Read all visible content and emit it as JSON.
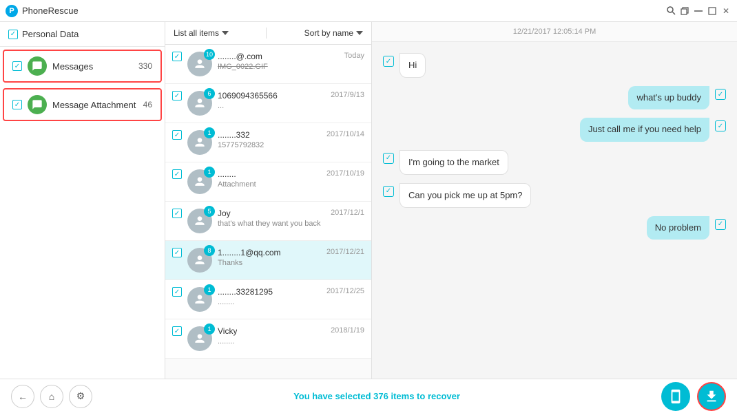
{
  "app": {
    "name": "PhoneRescue",
    "logo": "P"
  },
  "titlebar": {
    "controls": [
      "search",
      "restore",
      "minimize",
      "maximize",
      "close"
    ]
  },
  "sidebar": {
    "header": {
      "label": "Personal Data",
      "checked": true
    },
    "items": [
      {
        "id": "messages",
        "label": "Messages",
        "count": "330",
        "icon": "💬",
        "checked": true
      },
      {
        "id": "message-attachment",
        "label": "Message Attachment",
        "count": "46",
        "icon": "💬",
        "checked": true
      }
    ]
  },
  "middle": {
    "toolbar": {
      "list_label": "List all items",
      "sort_label": "Sort by name"
    },
    "messages": [
      {
        "id": 1,
        "badge": "10",
        "name": "........@.com",
        "date": "Today",
        "preview": "IMG_0022.GIF",
        "preview_strikethrough": true,
        "checked": true
      },
      {
        "id": 2,
        "badge": "6",
        "name": "1069094365566",
        "date": "2017/9/13",
        "preview": "...",
        "checked": true
      },
      {
        "id": 3,
        "badge": "1",
        "name": "........332",
        "date": "2017/10/14",
        "preview": "15775792832",
        "checked": true
      },
      {
        "id": 4,
        "badge": "1",
        "name": "........",
        "date": "2017/10/19",
        "preview": "Attachment",
        "checked": true
      },
      {
        "id": 5,
        "badge": "5",
        "name": "Joy",
        "date": "2017/12/1",
        "preview": "that's what they want you back",
        "checked": true
      },
      {
        "id": 6,
        "badge": "8",
        "name": "1........1@qq.com",
        "date": "2017/12/21",
        "preview": "Thanks",
        "checked": true,
        "active": true
      },
      {
        "id": 7,
        "badge": "1",
        "name": "........33281295",
        "date": "2017/12/25",
        "preview": "........",
        "checked": true
      },
      {
        "id": 8,
        "badge": "1",
        "name": "Vicky",
        "date": "2018/1/19",
        "preview": "........",
        "checked": true
      }
    ]
  },
  "chat": {
    "timestamp": "12/21/2017 12:05:14 PM",
    "messages": [
      {
        "id": 1,
        "type": "incoming",
        "text": "Hi",
        "checked": true
      },
      {
        "id": 2,
        "type": "outgoing",
        "text": "what's up buddy",
        "checked": true
      },
      {
        "id": 3,
        "type": "outgoing",
        "text": "Just call me if you need help",
        "checked": true
      },
      {
        "id": 4,
        "type": "incoming",
        "text": "I'm going to the market",
        "checked": true
      },
      {
        "id": 5,
        "type": "incoming",
        "text": "Can you pick me up at 5pm?",
        "checked": true
      },
      {
        "id": 6,
        "type": "outgoing",
        "text": "No problem",
        "checked": true
      }
    ]
  },
  "bottom": {
    "status_text": "You have selected ",
    "status_count": "376",
    "status_suffix": " items to recover",
    "back_btn": "←",
    "home_btn": "⌂",
    "settings_btn": "⚙"
  }
}
